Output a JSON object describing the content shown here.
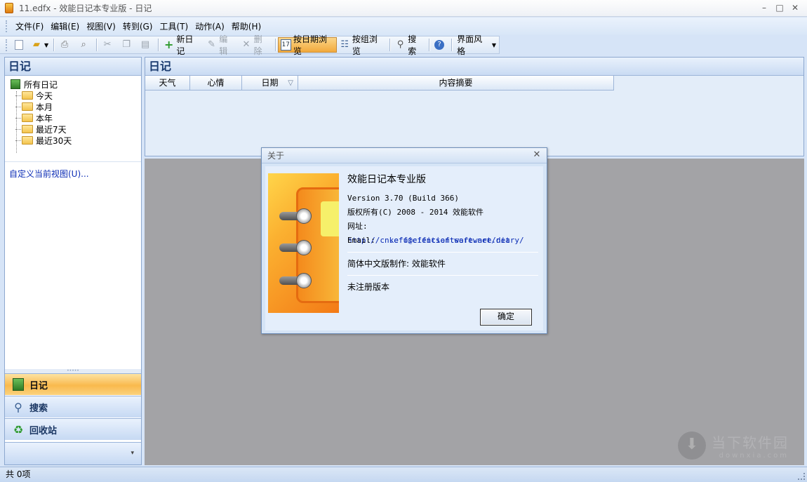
{
  "window": {
    "title": "11.edfx - 效能日记本专业版 - 日记",
    "minimize": "–",
    "maximize": "□",
    "close": "✕"
  },
  "menu": [
    "文件(F)",
    "编辑(E)",
    "视图(V)",
    "转到(G)",
    "工具(T)",
    "动作(A)",
    "帮助(H)"
  ],
  "toolbar": {
    "new_diary": "新日记",
    "edit": "编辑",
    "delete": "删除",
    "by_date": "按日期浏览",
    "by_group": "按组浏览",
    "search": "搜索",
    "theme": "界面风格"
  },
  "left_panel": {
    "header": "日记",
    "tree_root": "所有日记",
    "tree_items": [
      "今天",
      "本月",
      "本年",
      "最近7天",
      "最近30天"
    ],
    "custom_view": "自定义当前视图(U)...",
    "splitter_dots": "•••••",
    "nav": [
      {
        "label": "日记",
        "icon": "diary-icon",
        "active": true
      },
      {
        "label": "搜索",
        "icon": "magnifier-icon",
        "active": false
      },
      {
        "label": "回收站",
        "icon": "recycle-bin-icon",
        "active": false
      }
    ],
    "more": "▾"
  },
  "right_panel": {
    "header": "日记",
    "columns": [
      "天气",
      "心情",
      "日期",
      "内容摘要"
    ]
  },
  "watermark": {
    "main": "当下软件园",
    "sub": "downxia.com"
  },
  "status": {
    "text": "共 0项"
  },
  "about": {
    "title": "关于",
    "product": "效能日记本专业版",
    "version": "Version 3.70 (Build 366)",
    "copyright": "版权所有(C) 2008 - 2014 效能软件",
    "website_label": "网址:",
    "website_url": "http://cn.efficientsoftware.net/diary/",
    "email_label": "Email:",
    "email": "kefu@efficientsoftware.net",
    "localization": "简体中文版制作: 效能软件",
    "registration": "未注册版本",
    "ok": "确定"
  }
}
